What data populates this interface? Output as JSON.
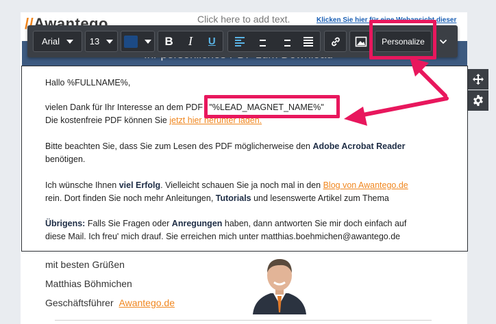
{
  "header": {
    "logo_main": "Awantego",
    "logo_prefix": "//",
    "click_to_add": "Click here to add text.",
    "webview_link": "Klicken Sie hier für eine Webansicht dieser",
    "banner_title": "Ihr persönliches PDF zum Download"
  },
  "toolbar": {
    "font_family": "Arial",
    "font_size": "13",
    "text_color": "#1c4a85",
    "bold_label": "B",
    "italic_label": "I",
    "underline_label": "U",
    "personalize_label": "Personalize"
  },
  "body": {
    "greeting": "Hallo %FULLNAME%,",
    "p1_line1_prefix": "vielen Dank für Ihr Interesse an dem PDF ",
    "p1_merge_tag": "\"%LEAD_MAGNET_NAME%\"",
    "p1_line2_prefix": "Die kostenfreie PDF können Sie ",
    "p1_download_link": "jetzt hier herunter laden.",
    "p2_line1_prefix": "Bitte beachten Sie, dass Sie zum Lesen des PDF möglicherweise den ",
    "p2_bold": "Adobe Acrobat Reader",
    "p2_line2": "benötigen.",
    "p3_line1_prefix": "Ich wünsche Ihnen ",
    "p3_bold1": "viel Erfolg",
    "p3_line1_mid": ". Vielleicht schauen Sie ja noch mal in den ",
    "p3_link": "Blog von Awantego.de",
    "p3_line2_prefix": "rein. Dort finden Sie noch mehr Anleitungen, ",
    "p3_bold2": "Tutorials",
    "p3_line2_suffix": " und lesenswerte Artikel zum Thema",
    "p4_bold1": "Übrigens:",
    "p4_line1_mid": " Falls Sie Fragen oder ",
    "p4_bold2": "Anregungen",
    "p4_line1_suffix": " haben, dann antworten Sie mir doch einfach auf",
    "p4_line2": "diese Mail. Ich freu' mich drauf. Sie erreichen mich unter matthias.boehmichen@awantego.de"
  },
  "signature": {
    "closing": "mit besten Grüßen",
    "name": "Matthias Böhmichen",
    "title_prefix": "Geschäftsführer ",
    "company_link": "Awantego.de"
  },
  "colors": {
    "highlight": "#e8175d",
    "link": "#f0861e",
    "toolbar_bg": "#3b3f45",
    "banner": "#3d5a80"
  }
}
